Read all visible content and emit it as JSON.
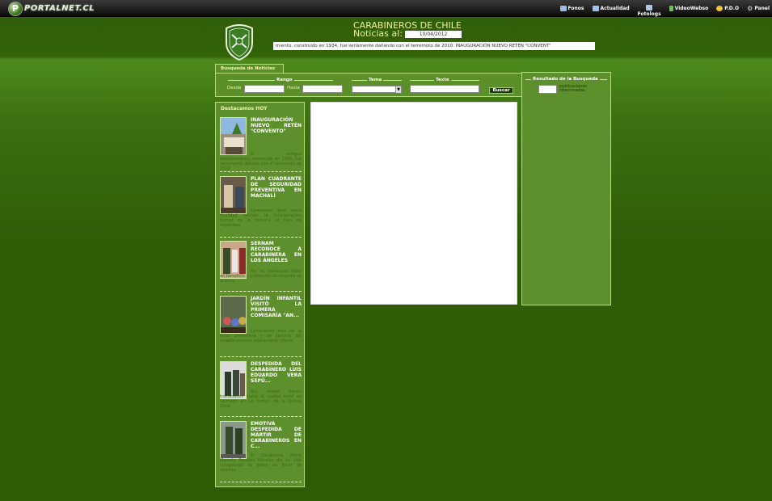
{
  "topbar": {
    "logo_letter": "P",
    "logo_text": "PORTALNET.CL",
    "nav": [
      {
        "label": "Fonos",
        "icon": "phone-icon",
        "color": "#9bbbe8"
      },
      {
        "label": "Actualidad",
        "icon": "newspaper-icon",
        "color": "#9cc3ef"
      },
      {
        "label": "Fotologs",
        "icon": "camera-icon",
        "color": "#b0c4de"
      },
      {
        "label": "VideoWebso",
        "icon": "video-icon",
        "color": "#6fbe5a"
      },
      {
        "label": "P.D.O",
        "icon": "smiley-icon",
        "color": "#f0c040"
      },
      {
        "label": "Panel",
        "icon": "gear-icon",
        "color": "#cfcfcf"
      }
    ]
  },
  "header": {
    "title": "CARABINEROS DE CHILE",
    "news_label": "Noticias al:",
    "date": "10/04/2012",
    "ticker": "miento, construido en 1934, fue seriamente dañando con el terremoto de 2010.   INAUGURACIÓN NUEVO RETÉN \"CONVENT\""
  },
  "search": {
    "tab_label": "Busqueda de Noticias",
    "range_legend": "Rango",
    "from_label": "Desde",
    "to_label": "Hasta",
    "topic_legend": "Tema",
    "text_legend": "Texto",
    "button_label": "Buscar"
  },
  "results": {
    "legend": "Resultado de la Busqueda",
    "count_label": "publicaciones relacionadas"
  },
  "featured": {
    "title": "Destacamos HOY",
    "items": [
      {
        "headline": "INAUGURACIÓN NUEVO RETÉN \"CONVENTO\"",
        "summary": "El antiguo destacamento, construido en 1934, fue seriamente dañado con el terremoto de 2010."
      },
      {
        "headline": "PLAN CUADRANTE DE SEGURIDAD PREVENTIVA EN MACHALÍ",
        "summary": "Ceremonia llevó como finalidad realizar la incorporación formal de la comuna al plan de seguridad."
      },
      {
        "headline": "SERNAM RECONOCE A CARABINERA EN LOS ÁNGELES",
        "summary": "Por su destacada labor en beneficio y protección de mujeres de la zona."
      },
      {
        "headline": "JARDÍN INFANTIL VISITÓ LA PRIMERA COMISARÍA \"AN...",
        "summary": "Conociendo más de la labor preventiva y de servicio del establecimiento educacional infantil."
      },
      {
        "headline": "DESPEDIDA DEL CARABINERO LUIS EDUARDO VERA SEPÚ...",
        "summary": "Sus restos fueron trasladados hasta la ciudad natal de Santiago en un cortejo de la Quinta Zona."
      },
      {
        "headline": "EMOTIVA DESPEDIDA DE MÁRTIR DE CARABINEROS EN C...",
        "summary": "El Carabinero Mario Marcelo Paredes Morales dio su vida cumpliendo su deber en labor de servicio."
      }
    ]
  },
  "colors": {
    "accent": "#f2f2b0",
    "panel": "#5e8f2d",
    "panel_border": "#b4dd7a",
    "background": "#2e5c06"
  }
}
